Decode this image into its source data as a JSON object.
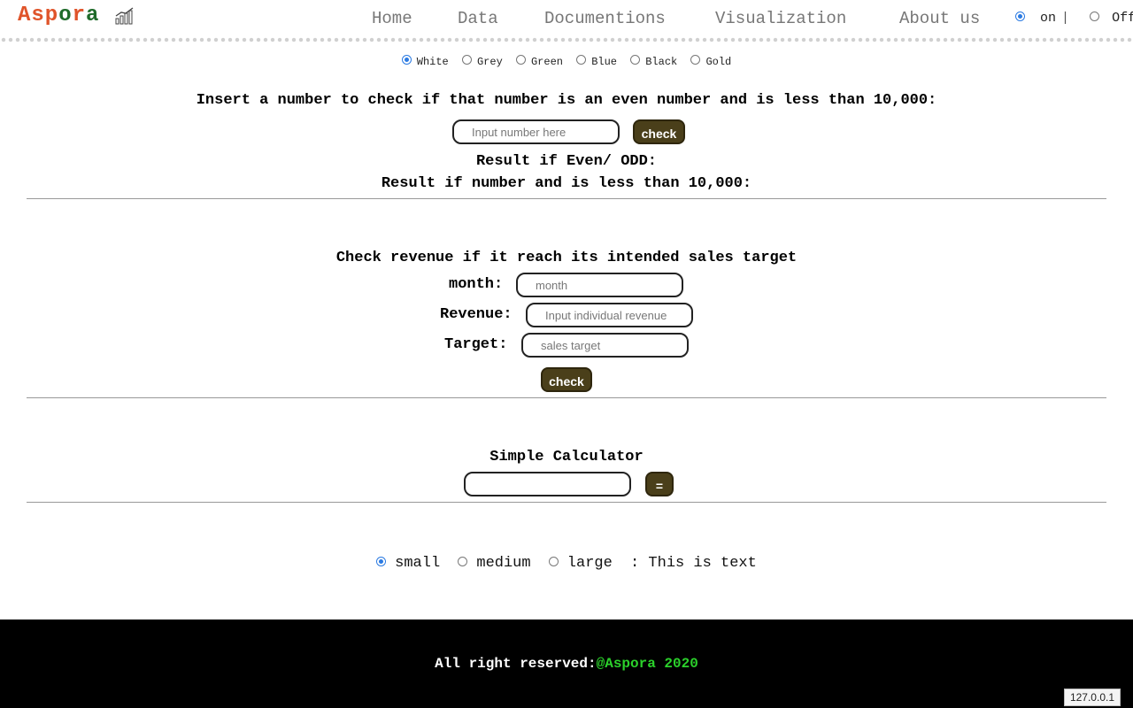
{
  "header": {
    "logo_part1": "Asp",
    "logo_part2": "o",
    "logo_part3": "r",
    "logo_part4": "a",
    "nav": [
      "Home",
      "Data",
      "Documentions",
      "Visualization",
      "About us"
    ],
    "toggle": {
      "on_label": "on",
      "separator": "|",
      "off_label": "Off",
      "selected": "on"
    }
  },
  "themes": {
    "options": [
      "White",
      "Grey",
      "Green",
      "Blue",
      "Black",
      "Gold"
    ],
    "selected": "White"
  },
  "even_check": {
    "prompt": "Insert a number to check if that number is an even number and is less than 10,000:",
    "placeholder": "Input number here",
    "button": "check",
    "result_even_odd": "Result if Even/ ODD:",
    "result_less_than": "Result if number and is less than 10,000:"
  },
  "revenue_check": {
    "title": "Check revenue if it reach its intended sales target",
    "month_label": "month:",
    "month_placeholder": "month",
    "revenue_label": "Revenue:",
    "revenue_placeholder": "Input individual revenue",
    "target_label": "Target:",
    "target_placeholder": "sales target",
    "button": "check"
  },
  "calculator": {
    "title": "Simple Calculator",
    "input_value": "",
    "equals": "="
  },
  "text_size": {
    "options": [
      "small",
      "medium",
      "large"
    ],
    "selected": "small",
    "suffix": ": This is text"
  },
  "footer": {
    "text": "All right reserved:",
    "brand": "@Aspora 2020"
  },
  "host_badge": "127.0.0.1",
  "colors": {
    "logo_orange": "#e0542a",
    "logo_green": "#1f6b2a",
    "button_bg": "#4a3f1a",
    "footer_brand": "#2bd12b"
  }
}
